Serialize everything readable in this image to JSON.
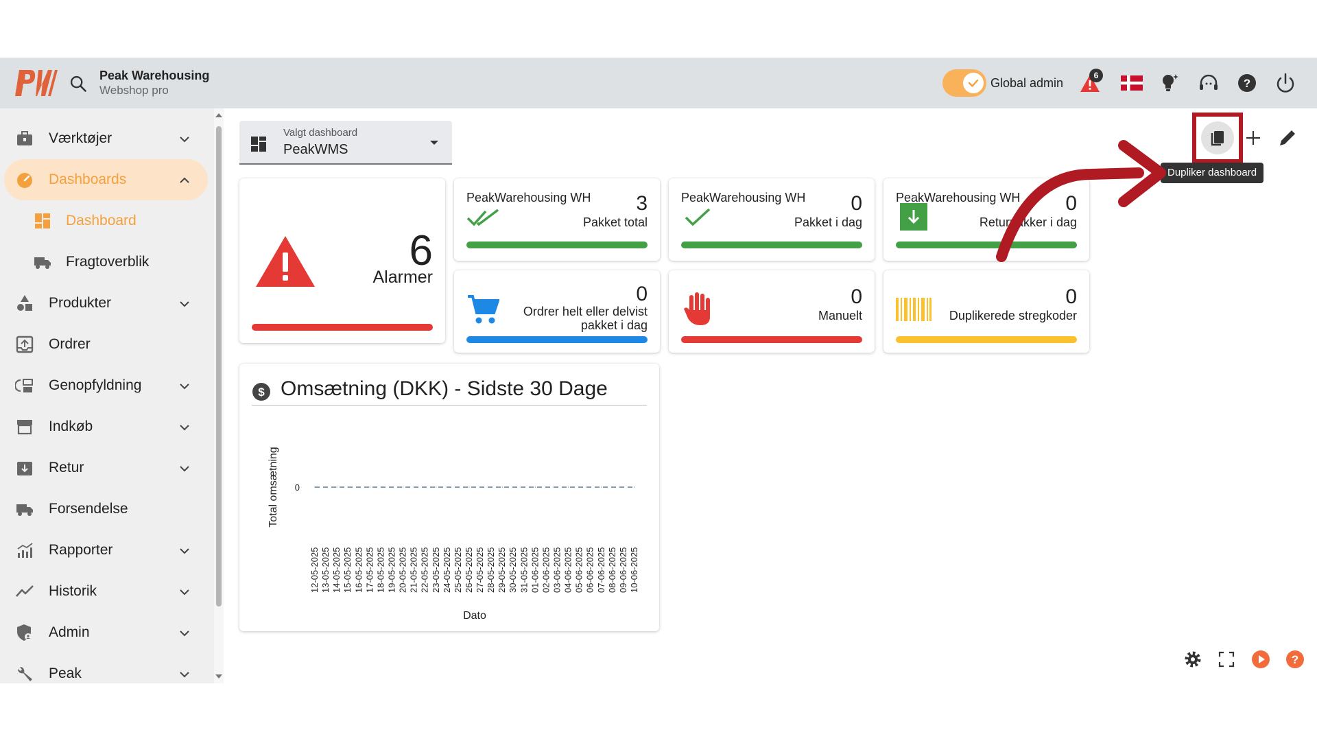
{
  "header": {
    "brand_name": "Peak Warehousing",
    "brand_sub": "Webshop pro",
    "admin_label": "Global admin",
    "alarm_count": "6",
    "accent": "#f4a03c"
  },
  "sidebar": {
    "items": [
      {
        "label": "Værktøjer",
        "icon": "toolbox-icon"
      },
      {
        "label": "Dashboards",
        "icon": "speedometer-icon"
      },
      {
        "label": "Dashboard",
        "icon": "dashboard-grid-icon"
      },
      {
        "label": "Fragtoverblik",
        "icon": "truck-icon"
      },
      {
        "label": "Produkter",
        "icon": "shapes-icon"
      },
      {
        "label": "Ordrer",
        "icon": "order-tray-icon"
      },
      {
        "label": "Genopfyldning",
        "icon": "refill-icon"
      },
      {
        "label": "Indkøb",
        "icon": "store-icon"
      },
      {
        "label": "Retur",
        "icon": "return-box-icon"
      },
      {
        "label": "Forsendelse",
        "icon": "shipping-truck-icon"
      },
      {
        "label": "Rapporter",
        "icon": "report-chart-icon"
      },
      {
        "label": "Historik",
        "icon": "trend-line-icon"
      },
      {
        "label": "Admin",
        "icon": "admin-shield-icon"
      },
      {
        "label": "Peak",
        "icon": "wrench-icon"
      }
    ]
  },
  "dashboard_select": {
    "label": "Valgt dashboard",
    "value": "PeakWMS"
  },
  "toolbar": {
    "duplicate_tooltip": "Dupliker dashboard"
  },
  "cards": {
    "alarms": {
      "value": "6",
      "label": "Alarmer",
      "color": "#e53935"
    },
    "packed_total": {
      "title": "PeakWarehousing WH",
      "value": "3",
      "label": "Pakket total",
      "color": "#43a047"
    },
    "packed_today": {
      "title": "PeakWarehousing WH",
      "value": "0",
      "label": "Pakket i dag",
      "color": "#43a047"
    },
    "returns_today": {
      "title": "PeakWarehousing WH",
      "value": "0",
      "label": "Returpakker i dag",
      "color": "#43a047"
    },
    "orders_partial": {
      "value": "0",
      "label_line1": "Ordrer helt eller delvist",
      "label_line2": "pakket i dag",
      "color": "#1e88e5"
    },
    "manual": {
      "value": "0",
      "label": "Manuelt",
      "color": "#e53935"
    },
    "duplicate_barcodes": {
      "value": "0",
      "label": "Duplikerede stregkoder",
      "color": "#fbc02d"
    }
  },
  "revenue": {
    "title": "Omsætning (DKK) - Sidste 30 Dage"
  },
  "chart_data": {
    "type": "line",
    "title": "Omsætning (DKK) - Sidste 30 Dage",
    "xlabel": "Dato",
    "ylabel": "Total omsætning",
    "x": [
      "12-05-2025",
      "13-05-2025",
      "14-05-2025",
      "15-05-2025",
      "16-05-2025",
      "17-05-2025",
      "18-05-2025",
      "19-05-2025",
      "20-05-2025",
      "21-05-2025",
      "22-05-2025",
      "23-05-2025",
      "24-05-2025",
      "25-05-2025",
      "26-05-2025",
      "27-05-2025",
      "28-05-2025",
      "29-05-2025",
      "30-05-2025",
      "31-05-2025",
      "01-06-2025",
      "02-06-2025",
      "03-06-2025",
      "04-06-2025",
      "05-06-2025",
      "06-06-2025",
      "07-06-2025",
      "08-06-2025",
      "09-06-2025",
      "10-06-2025"
    ],
    "series": [
      {
        "values": [
          0,
          0,
          0,
          0,
          0,
          0,
          0,
          0,
          0,
          0,
          0,
          0,
          0,
          0,
          0,
          0,
          0,
          0,
          0,
          0,
          0,
          0,
          0,
          0,
          0,
          0,
          0,
          0,
          0,
          0
        ]
      }
    ],
    "y_ticks": [
      "0"
    ],
    "grid": false,
    "line_style": "dashed"
  }
}
